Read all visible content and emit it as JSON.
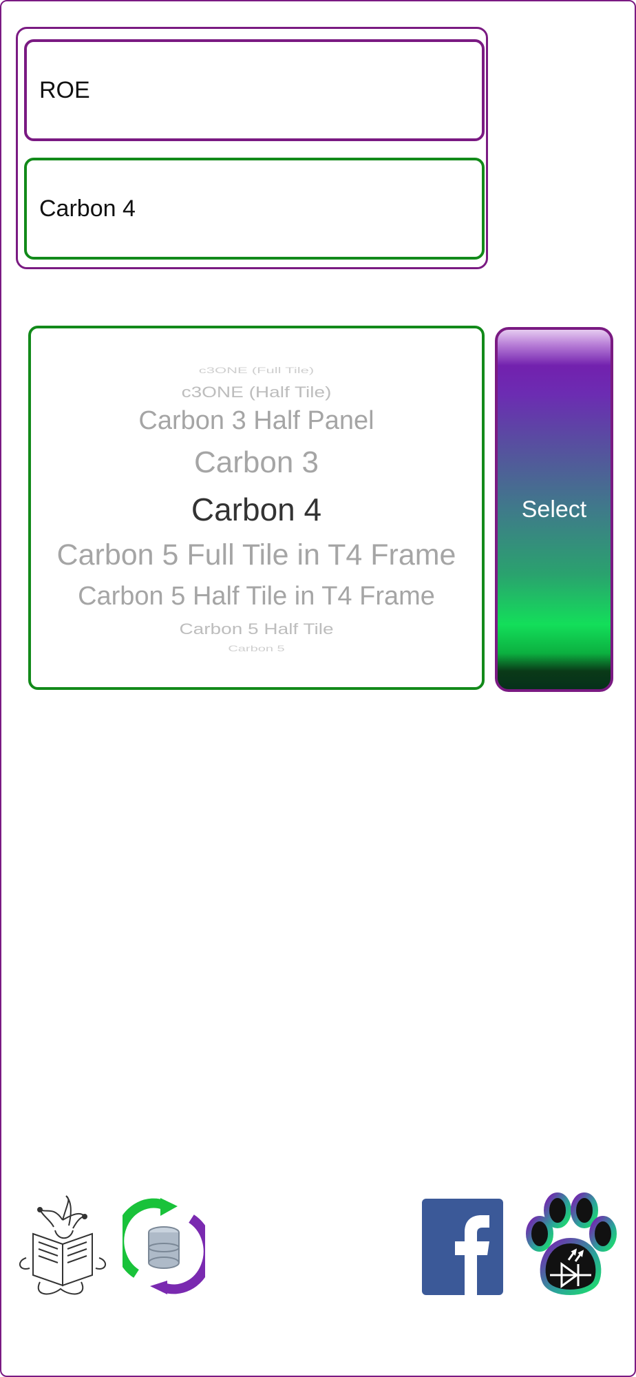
{
  "selectors": {
    "first_value": "ROE",
    "second_value": "Carbon 4"
  },
  "picker": {
    "items": [
      "c3ONE (Full Tile)",
      "c3ONE (Half Tile)",
      "Carbon 3 Half Panel",
      "Carbon 3",
      "Carbon 4",
      "Carbon 5 Full Tile in T4 Frame",
      "Carbon 5 Half Tile in T4 Frame",
      "Carbon 5 Half Tile",
      "Carbon 5"
    ],
    "selected": "Carbon 4"
  },
  "select_button": {
    "label": "Select"
  },
  "footer_icons": [
    "jester-reading-icon",
    "database-sync-icon",
    "facebook-icon",
    "paw-diode-icon"
  ],
  "colors": {
    "purple": "#7a1a82",
    "green": "#128a1a",
    "facebook": "#3b5998"
  }
}
